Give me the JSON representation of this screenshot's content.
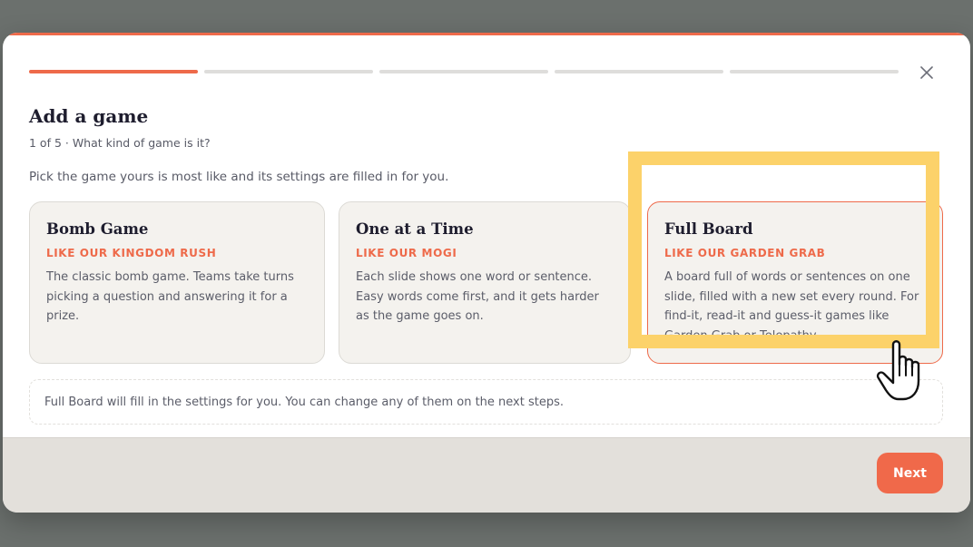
{
  "modal": {
    "title": "Add a game",
    "step": "1 of 5 · What kind of game is it?",
    "intro": "Pick the game yours is most like and its settings are filled in for you.",
    "progress": {
      "current_step": 1,
      "total_steps": 5
    },
    "close_icon": "close-icon"
  },
  "cards": [
    {
      "title": "Bomb Game",
      "subtitle": "LIKE OUR KINGDOM RUSH",
      "description": "The classic bomb game. Teams take turns picking a question and answering it for a prize."
    },
    {
      "title": "One at a Time",
      "subtitle": "LIKE OUR MOGI",
      "description": "Each slide shows one word or sentence. Easy words come first, and it gets harder as the game goes on."
    },
    {
      "title": "Full Board",
      "subtitle": "LIKE OUR GARDEN GRAB",
      "description": "A board full of words or sentences on one slide, filled with a new set every round. For find-it, read-it and guess-it games like Garden Grab or Telepathy."
    }
  ],
  "selected_card": "Full Board",
  "note": "Full Board will fill in the settings for you. You can change any of them on the next steps.",
  "footer": {
    "next_label": "Next"
  },
  "colors": {
    "accent": "#ee6a4a",
    "highlight": "#fcd26a",
    "card_bg": "#f4f2ee",
    "footer_bg": "#e3e0db"
  },
  "icons": {
    "close": "close-icon",
    "cursor": "hand-pointer-icon"
  }
}
